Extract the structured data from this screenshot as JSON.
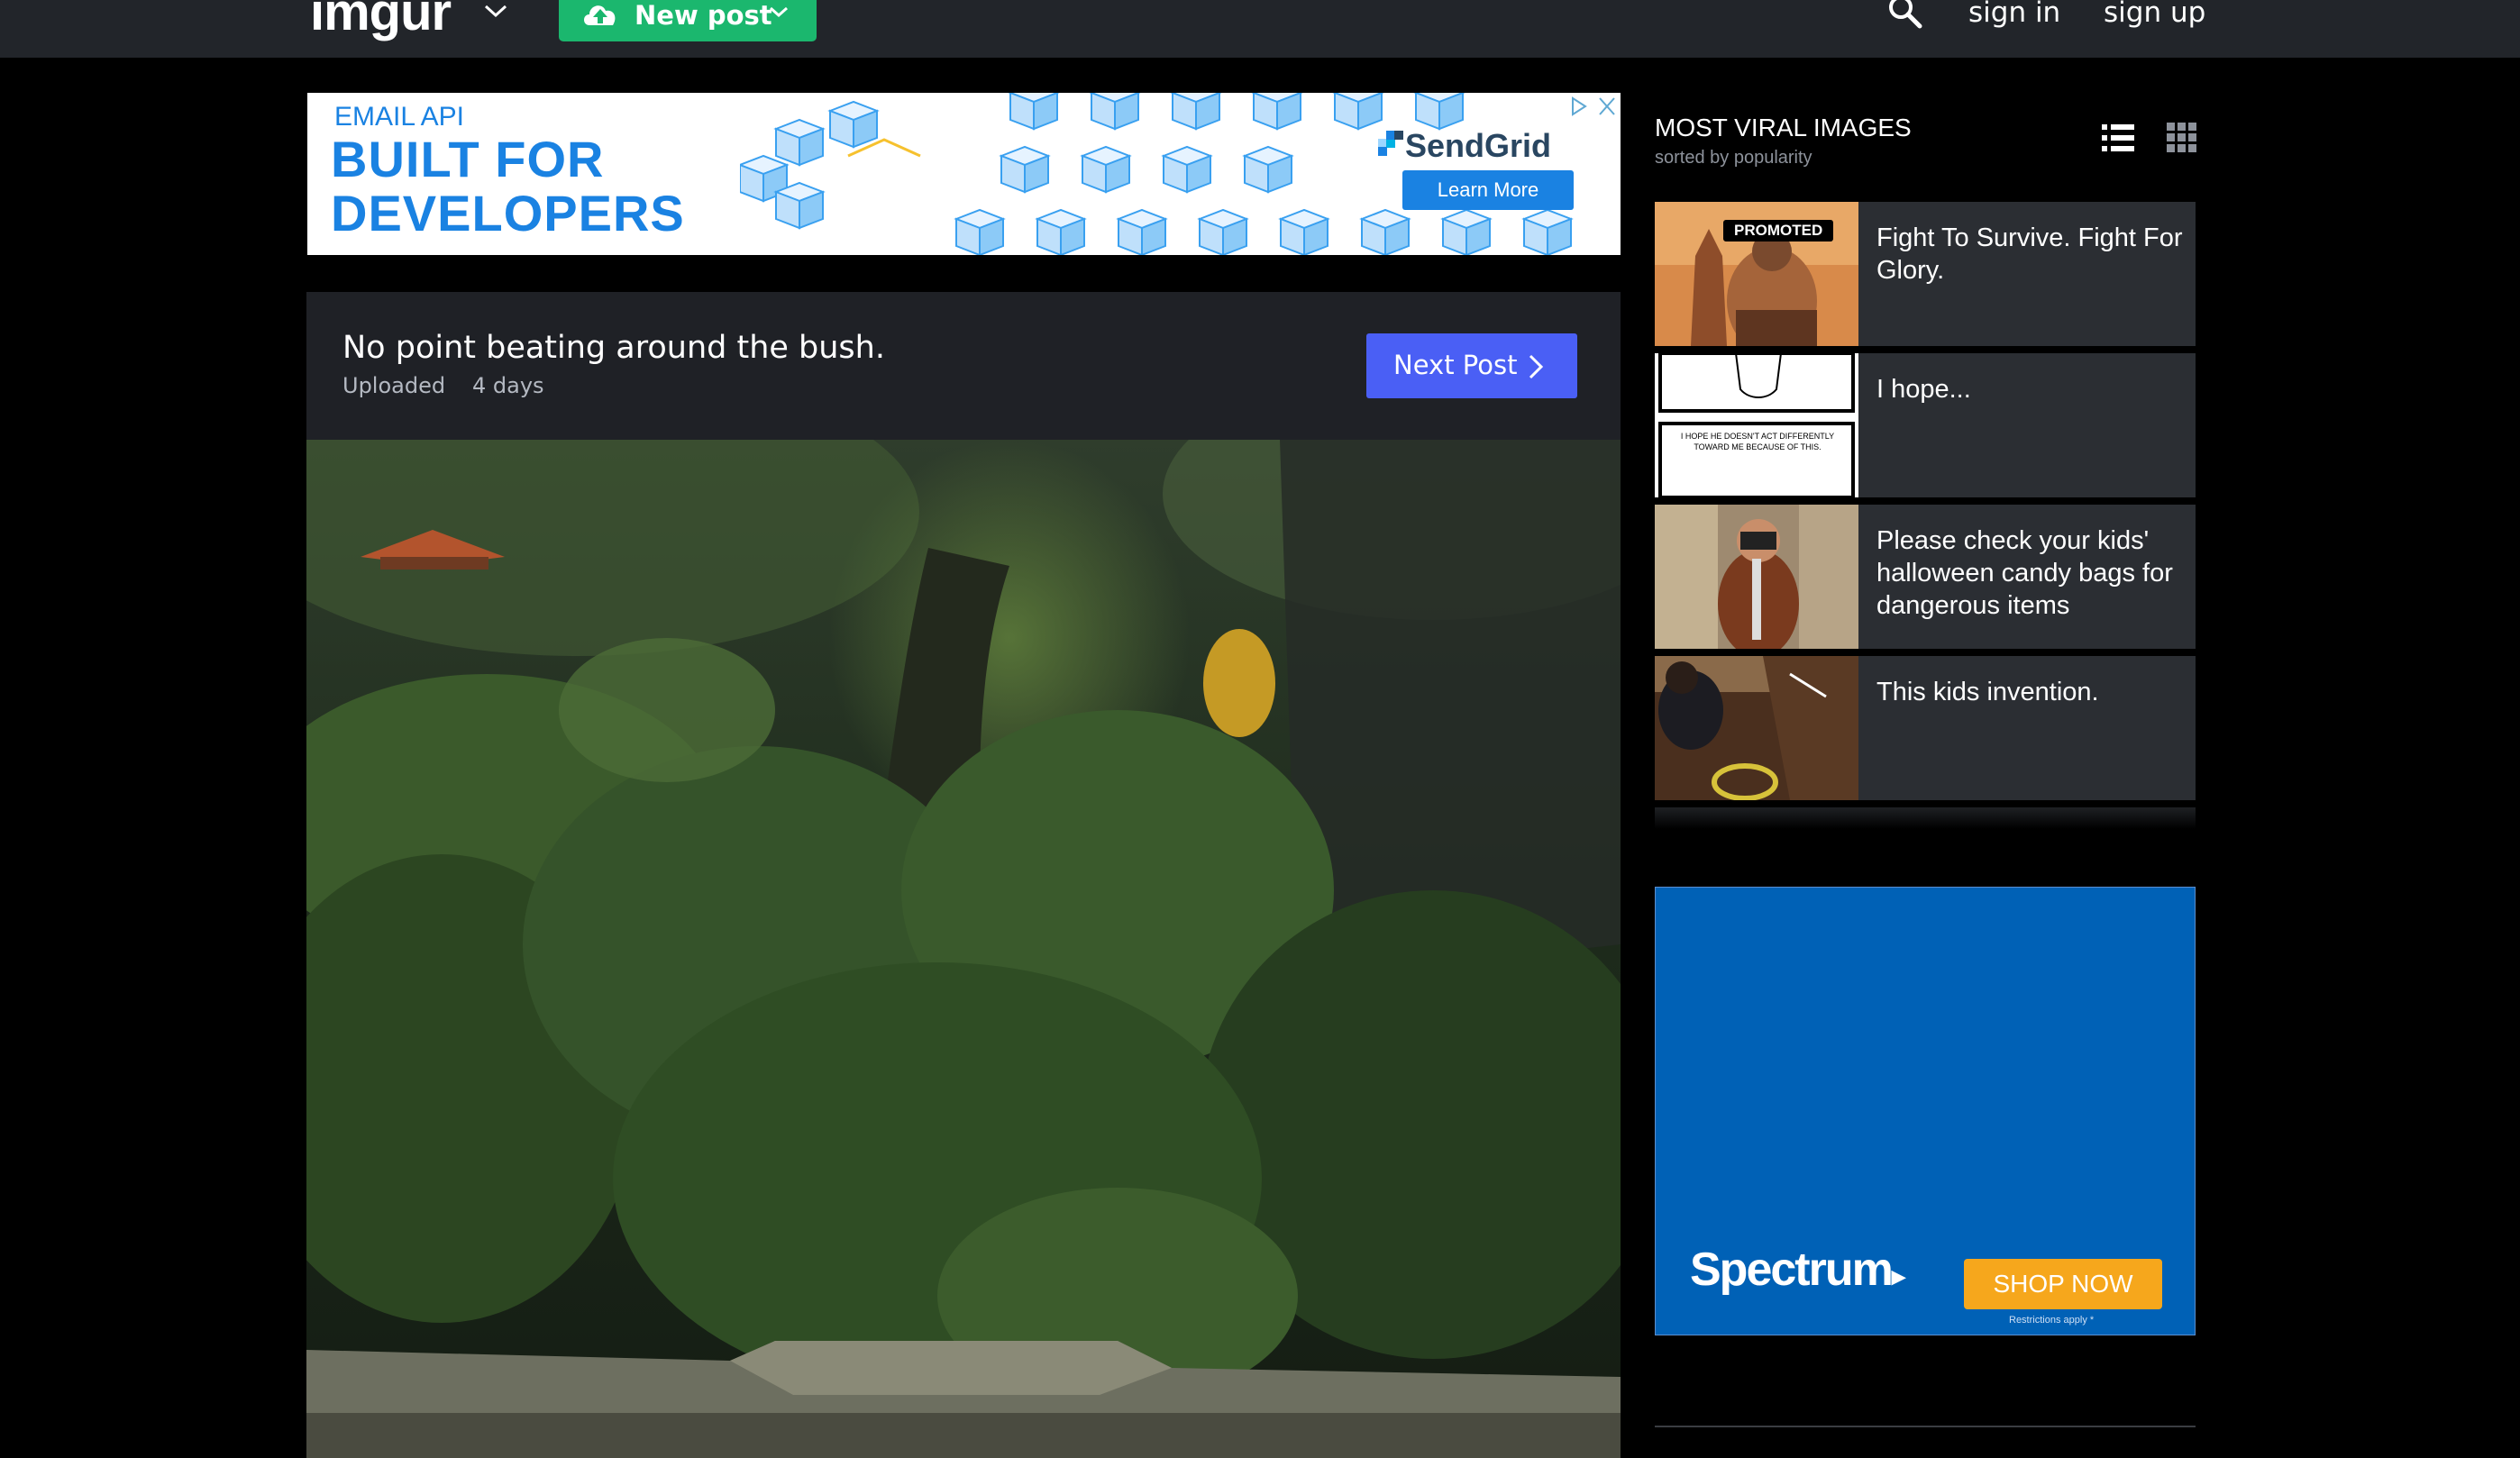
{
  "header": {
    "logo": "imgur",
    "new_post_label": "New post",
    "sign_in": "sign in",
    "sign_up": "sign up"
  },
  "ad_top": {
    "kicker": "EMAIL API",
    "headline_1": "BUILT FOR",
    "headline_2": "DEVELOPERS",
    "brand": "SendGrid",
    "cta": "Learn More"
  },
  "post": {
    "title": "No point beating around the bush.",
    "uploaded_label": "Uploaded",
    "uploaded_time": "4 days",
    "next_label": "Next Post"
  },
  "sidebar": {
    "title": "MOST VIRAL IMAGES",
    "subtitle": "sorted by popularity",
    "items": [
      {
        "title": "Fight To Survive. Fight For Glory.",
        "badge": "PROMOTED"
      },
      {
        "title": "I hope...",
        "thumb_caption": "I HOPE HE DOESN'T ACT DIFFERENTLY TOWARD ME BECAUSE OF THIS."
      },
      {
        "title": "Please check your kids' halloween candy bags for dangerous items"
      },
      {
        "title": "This kids invention."
      }
    ]
  },
  "ad_side": {
    "brand": "Spectrum",
    "cta": "SHOP NOW",
    "fine_print": "Restrictions apply *"
  },
  "colors": {
    "topbar": "#22252a",
    "new_post_green": "#1bb76e",
    "next_post_blue": "#4a5ff5",
    "card_bg": "#2b2e33",
    "spectrum_blue": "#0061b6",
    "spectrum_orange": "#f6a71c",
    "sendgrid_blue": "#1a82e2"
  }
}
